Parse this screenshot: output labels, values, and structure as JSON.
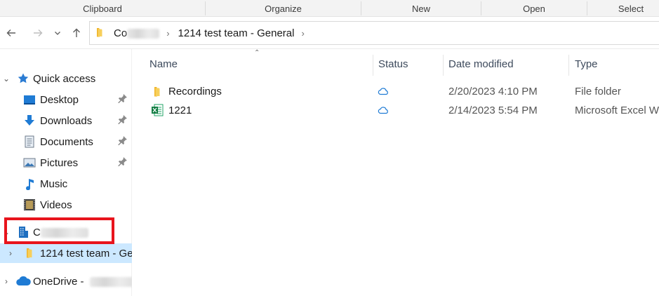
{
  "ribbon": {
    "groups": [
      "Clipboard",
      "Organize",
      "New",
      "Open",
      "Select"
    ]
  },
  "nav": {
    "back_icon": "back-arrow-icon",
    "forward_icon": "forward-arrow-icon",
    "recent_icon": "chevron-down-icon",
    "up_icon": "up-arrow-icon"
  },
  "address": {
    "crumb1_prefix": "Co",
    "crumb2": "1214 test team - General"
  },
  "sidebar": {
    "quick_access": "Quick access",
    "items": [
      {
        "label": "Desktop",
        "icon": "desktop-icon",
        "pinned": true
      },
      {
        "label": "Downloads",
        "icon": "download-icon",
        "pinned": true
      },
      {
        "label": "Documents",
        "icon": "documents-icon",
        "pinned": true
      },
      {
        "label": "Pictures",
        "icon": "pictures-icon",
        "pinned": true
      },
      {
        "label": "Music",
        "icon": "music-icon",
        "pinned": false
      },
      {
        "label": "Videos",
        "icon": "videos-icon",
        "pinned": false
      }
    ],
    "org_label": "C",
    "team_folder": "1214 test team - Ge",
    "onedrive": "OneDrive -"
  },
  "columns": {
    "name": "Name",
    "status": "Status",
    "date": "Date modified",
    "type": "Type"
  },
  "files": [
    {
      "name": "Recordings",
      "icon": "folder-icon",
      "status": "cloud-icon",
      "date": "2/20/2023 4:10 PM",
      "type": "File folder"
    },
    {
      "name": "1221",
      "icon": "excel-icon",
      "status": "cloud-icon",
      "date": "2/14/2023 5:54 PM",
      "type": "Microsoft Excel W"
    }
  ],
  "colors": {
    "selected_bg": "#cce8ff",
    "highlight_box": "#e8141c",
    "accent_blue": "#1a73c9",
    "folder_yellow": "#f3c13a"
  }
}
